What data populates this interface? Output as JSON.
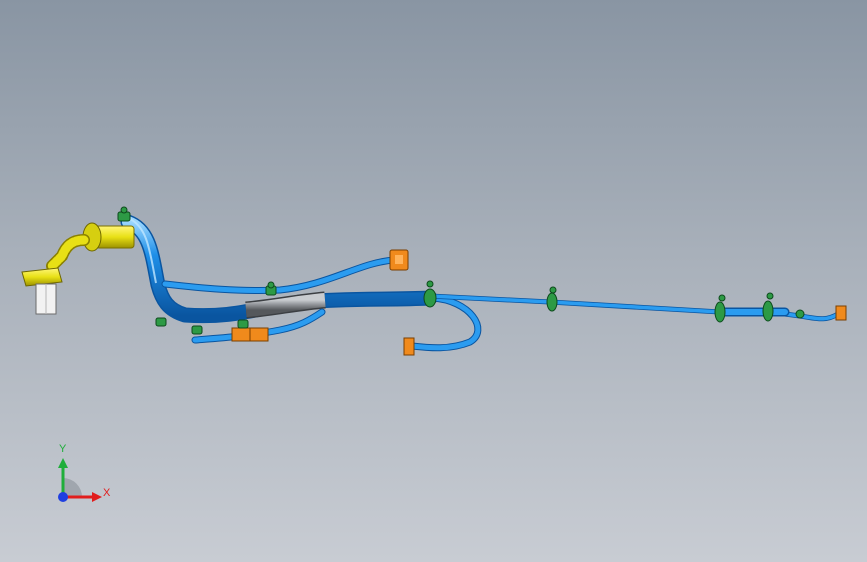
{
  "viewport": {
    "background_top": "#8995a3",
    "background_bottom": "#c8ccd3"
  },
  "model": {
    "description_icon": "wire-harness-3d-model",
    "colors": {
      "harness_tube": "#1e8fe8",
      "harness_tube_highlight": "#8fd0ff",
      "harness_tube_shadow": "#0a55a0",
      "convolute_sleeve": "#8c8f94",
      "main_connector": "#e8e015",
      "clip": "#1f8a3a",
      "terminal_connector": "#f08a1c",
      "white_housing": "#f2f2f2"
    }
  },
  "triad": {
    "y_label": "Y",
    "x_label": "X",
    "y_color": "#1fae3a",
    "x_color": "#e11d1d",
    "z_color": "#1f3fe0"
  }
}
